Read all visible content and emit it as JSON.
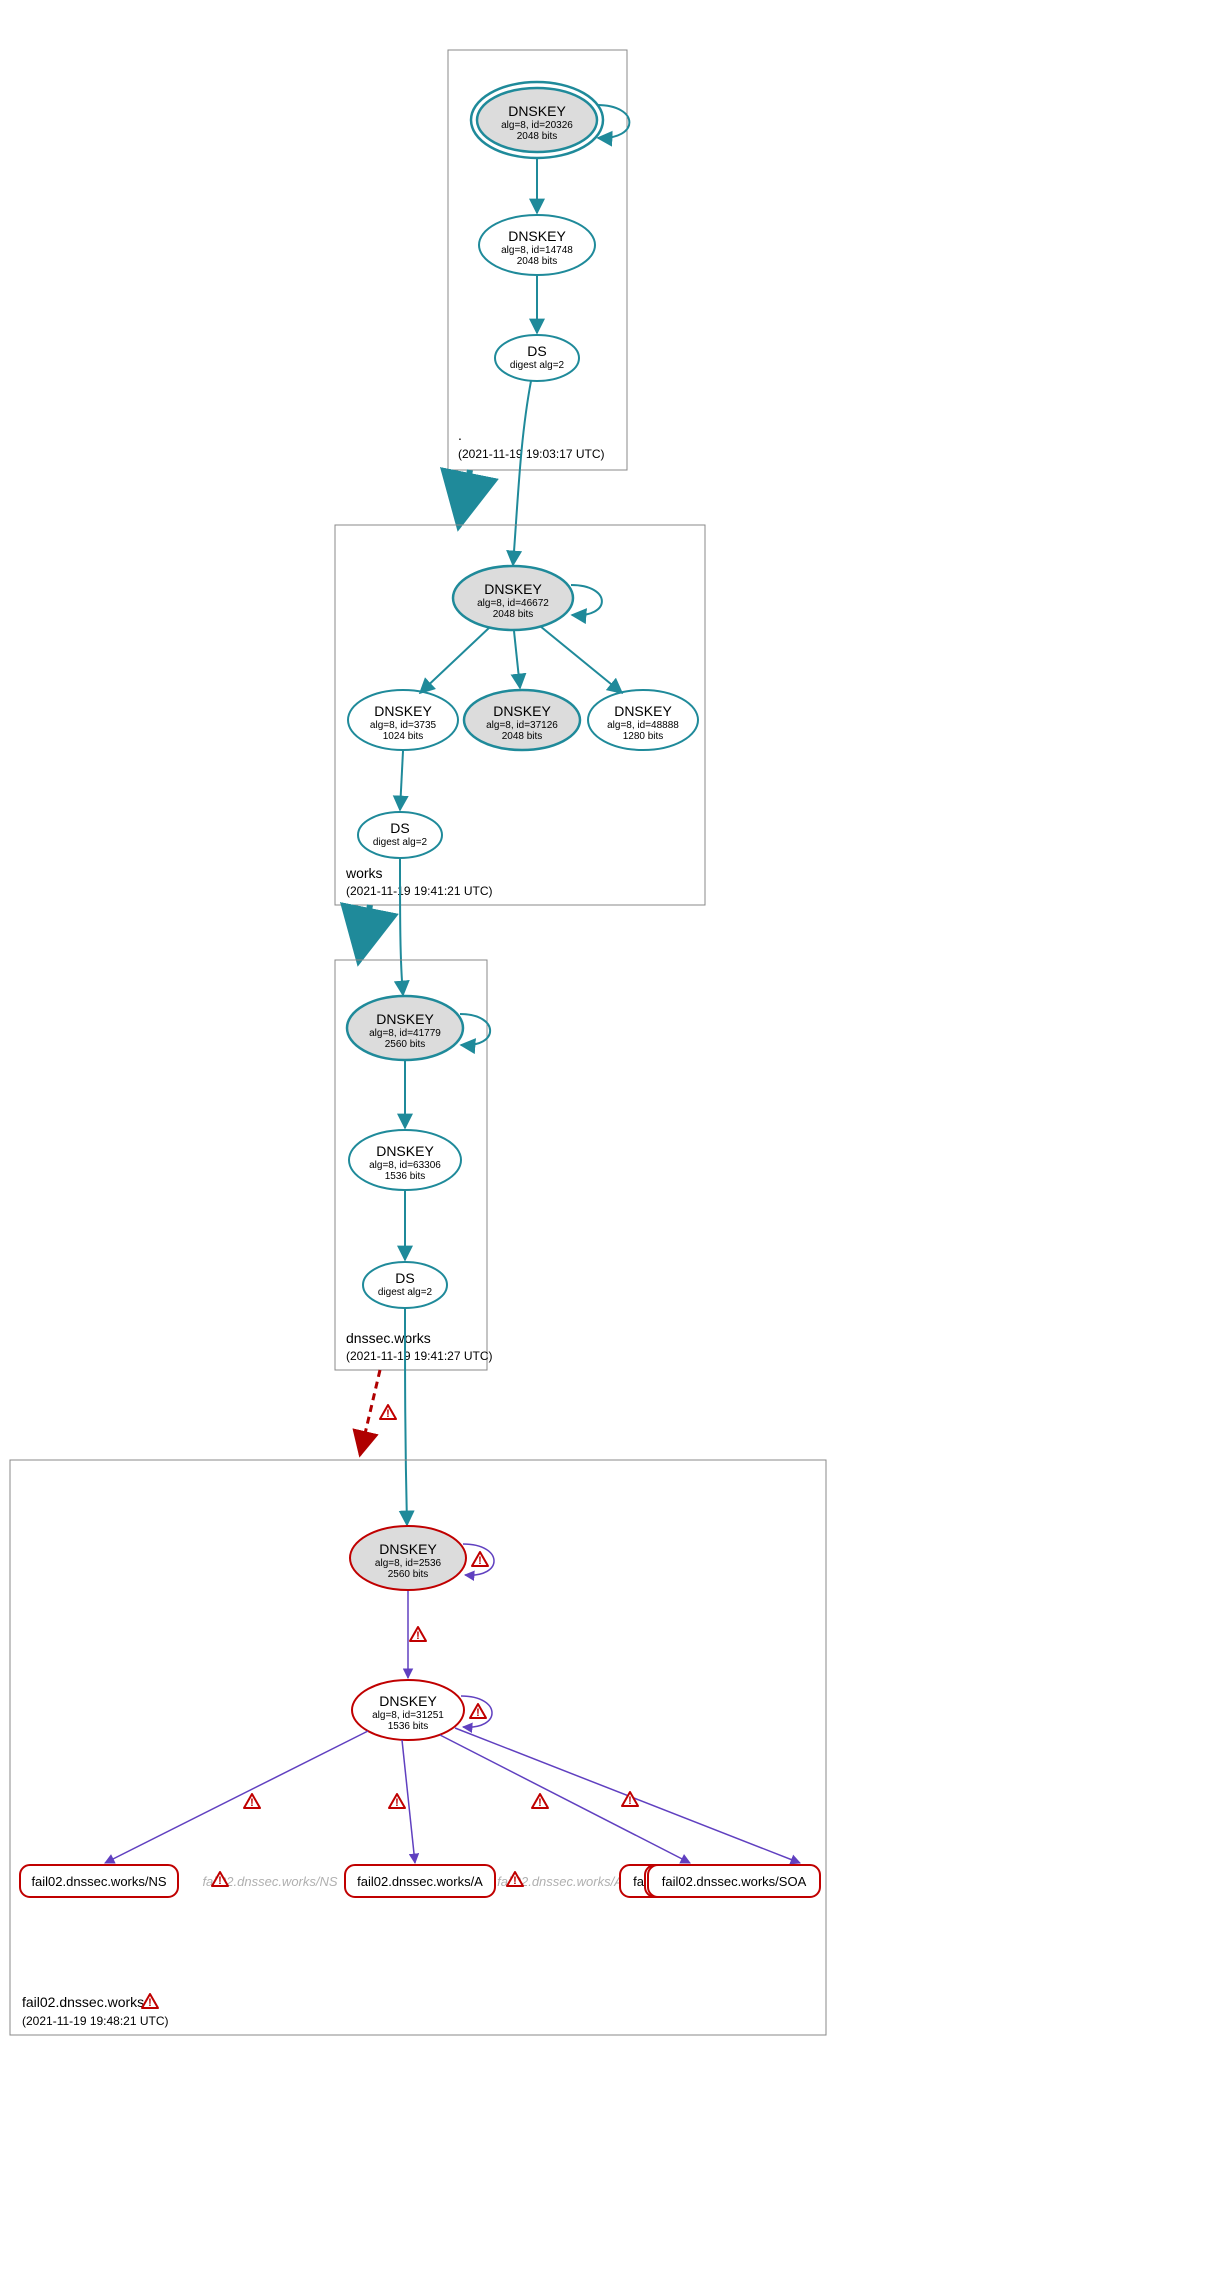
{
  "zones": {
    "root": {
      "label": ".",
      "ts": "(2021-11-19 19:03:17 UTC)"
    },
    "works": {
      "label": "works",
      "ts": "(2021-11-19 19:41:21 UTC)"
    },
    "dnssec": {
      "label": "dnssec.works",
      "ts": "(2021-11-19 19:41:27 UTC)"
    },
    "fail02": {
      "label": "fail02.dnssec.works",
      "ts": "(2021-11-19 19:48:21 UTC)"
    }
  },
  "nodes": {
    "root_ksk": {
      "title": "DNSKEY",
      "sub1": "alg=8, id=20326",
      "sub2": "2048 bits"
    },
    "root_zsk": {
      "title": "DNSKEY",
      "sub1": "alg=8, id=14748",
      "sub2": "2048 bits"
    },
    "root_ds": {
      "title": "DS",
      "sub1": "digest alg=2",
      "sub2": ""
    },
    "works_ksk": {
      "title": "DNSKEY",
      "sub1": "alg=8, id=46672",
      "sub2": "2048 bits"
    },
    "works_zsk1": {
      "title": "DNSKEY",
      "sub1": "alg=8, id=3735",
      "sub2": "1024 bits"
    },
    "works_zsk2": {
      "title": "DNSKEY",
      "sub1": "alg=8, id=37126",
      "sub2": "2048 bits"
    },
    "works_zsk3": {
      "title": "DNSKEY",
      "sub1": "alg=8, id=48888",
      "sub2": "1280 bits"
    },
    "works_ds": {
      "title": "DS",
      "sub1": "digest alg=2",
      "sub2": ""
    },
    "dnssec_ksk": {
      "title": "DNSKEY",
      "sub1": "alg=8, id=41779",
      "sub2": "2560 bits"
    },
    "dnssec_zsk": {
      "title": "DNSKEY",
      "sub1": "alg=8, id=63306",
      "sub2": "1536 bits"
    },
    "dnssec_ds": {
      "title": "DS",
      "sub1": "digest alg=2",
      "sub2": ""
    },
    "fail_ksk": {
      "title": "DNSKEY",
      "sub1": "alg=8, id=2536",
      "sub2": "2560 bits"
    },
    "fail_zsk": {
      "title": "DNSKEY",
      "sub1": "alg=8, id=31251",
      "sub2": "1536 bits"
    }
  },
  "rrsets": {
    "ns": "fail02.dnssec.works/NS",
    "ns_grey": "fail02.dnssec.works/NS",
    "a": "fail02.dnssec.works/A",
    "a_grey": "fail02.dnssec.works/A",
    "aaaa": "fail02.dnssec.works/AAAA",
    "soa": "fail02.dnssec.works/SOA"
  },
  "colors": {
    "teal": "#1f8a9a",
    "red": "#c00000",
    "purple": "#6040c0",
    "grey": "#888888"
  }
}
